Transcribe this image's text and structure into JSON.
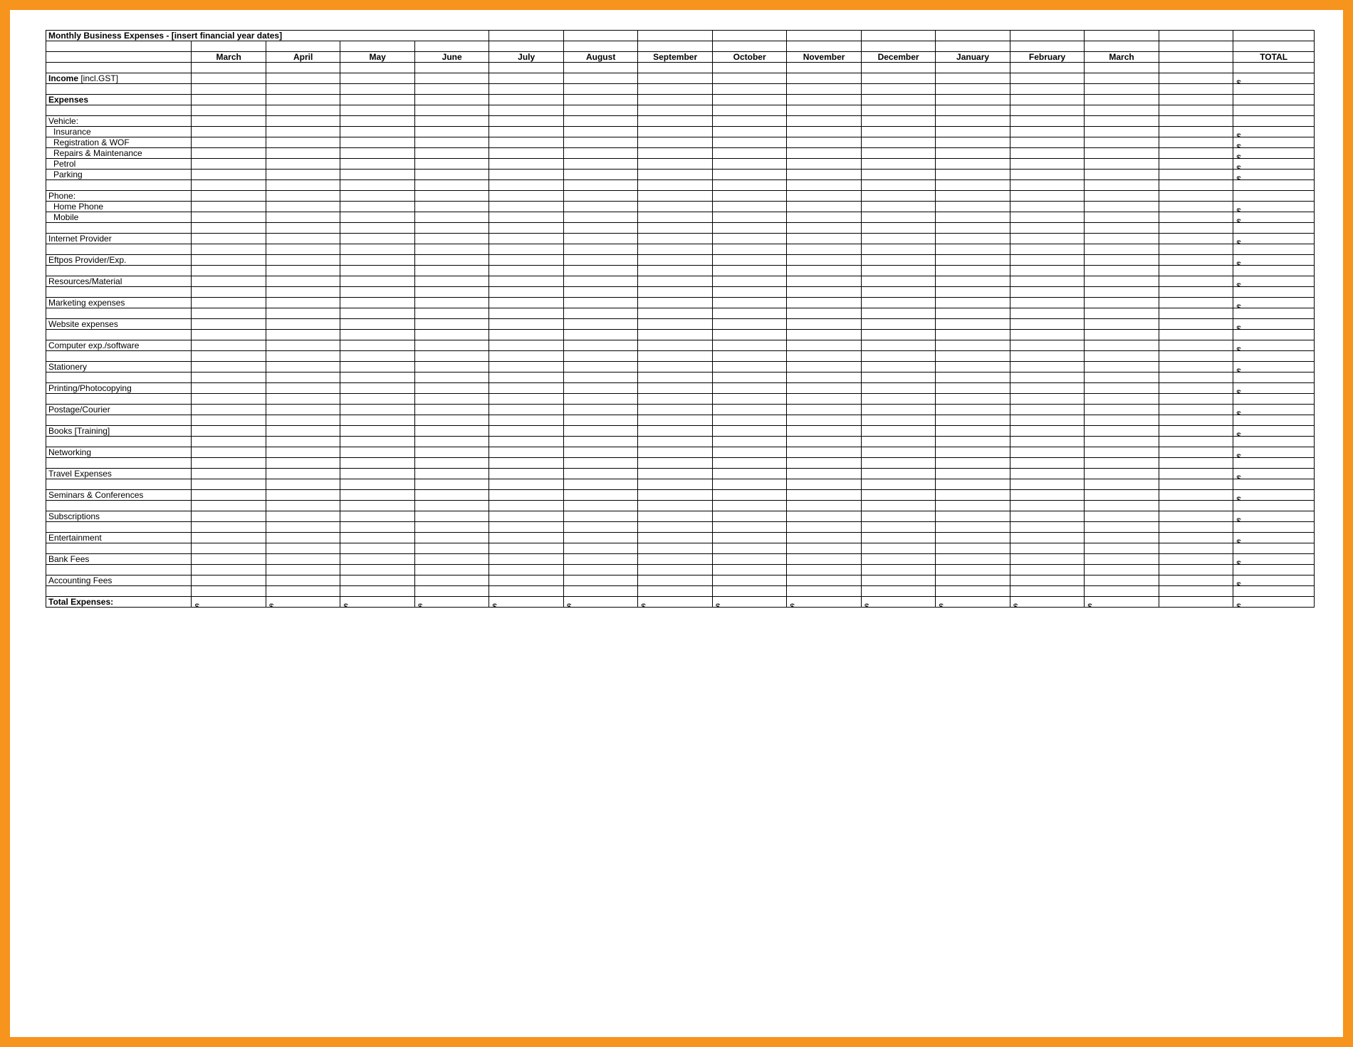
{
  "title": "Monthly Business Expenses - [insert financial year dates]",
  "months": [
    "March",
    "April",
    "May",
    "June",
    "July",
    "August",
    "September",
    "October",
    "November",
    "December",
    "January",
    "February",
    "March"
  ],
  "totalHeader": "TOTAL",
  "incomeLabel": "Income",
  "incomeSuffix": " [incl.GST]",
  "expensesHeader": "Expenses",
  "groups": [
    {
      "label": "Vehicle:",
      "items": [
        "Insurance",
        "Registration & WOF",
        "Repairs & Maintenance",
        "Petrol",
        "Parking"
      ]
    },
    {
      "label": "Phone:",
      "items": [
        "Home Phone",
        "Mobile"
      ]
    }
  ],
  "standalone": [
    "Internet Provider",
    "Eftpos Provider/Exp.",
    "Resources/Material",
    "Marketing expenses",
    "Website expenses",
    "Computer exp./software",
    "Stationery",
    "Printing/Photocopying",
    "Postage/Courier",
    "Books [Training]",
    "Networking",
    "Travel Expenses",
    "Seminars & Conferences",
    "Subscriptions",
    "Entertainment",
    "Bank Fees",
    "Accounting Fees"
  ],
  "totalExpensesLabel": "Total Expenses:",
  "currency": "$",
  "dash": "-"
}
